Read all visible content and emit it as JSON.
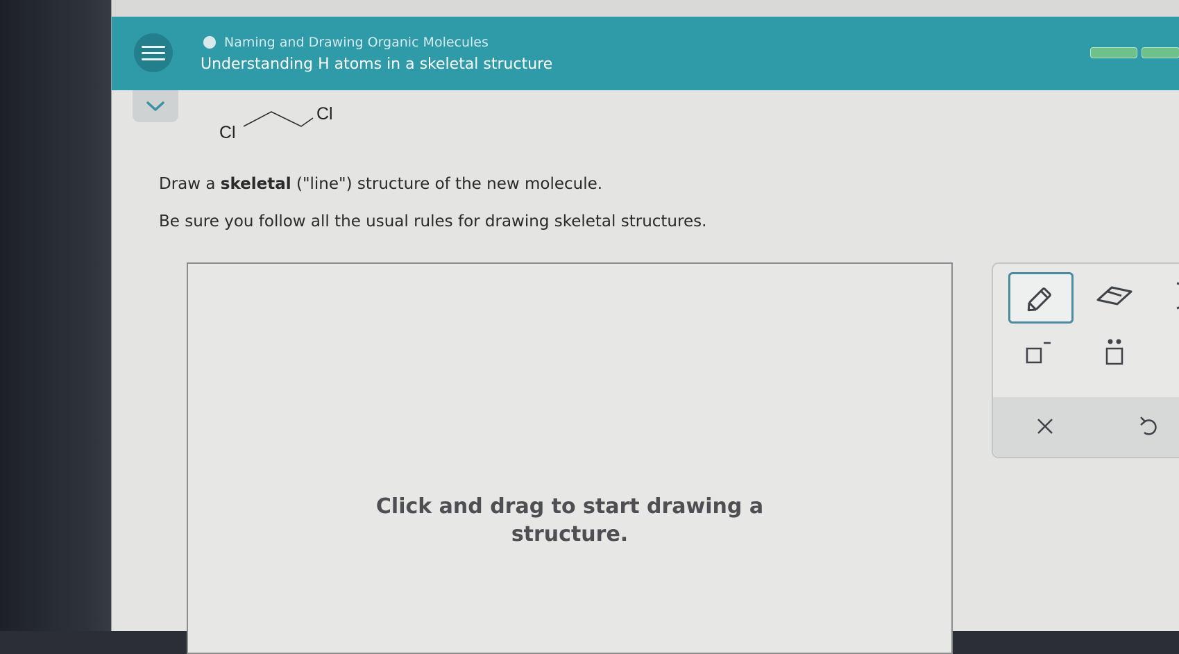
{
  "header": {
    "topic": "Naming and Drawing Organic Molecules",
    "title": "Understanding H atoms in a skeletal structure"
  },
  "molecule": {
    "left_atom": "Cl",
    "right_atom": "Cl"
  },
  "prompt": {
    "line1_prefix": "Draw a ",
    "line1_bold": "skeletal",
    "line1_suffix": " (\"line\") structure of the new molecule.",
    "line2": "Be sure you follow all the usual rules for drawing skeletal structures."
  },
  "canvas": {
    "hint_line1": "Click and drag to start drawing a",
    "hint_line2": "structure."
  },
  "toolbox": {
    "tools": [
      "pencil-icon",
      "eraser-icon",
      "template-icon",
      "negative-charge-icon",
      "lone-pair-icon"
    ],
    "actions": [
      "clear-icon",
      "undo-icon"
    ]
  },
  "colors": {
    "header": "#2f9aa8",
    "progress": "#6cc28a",
    "selected_tool_border": "#4d8aa0"
  }
}
